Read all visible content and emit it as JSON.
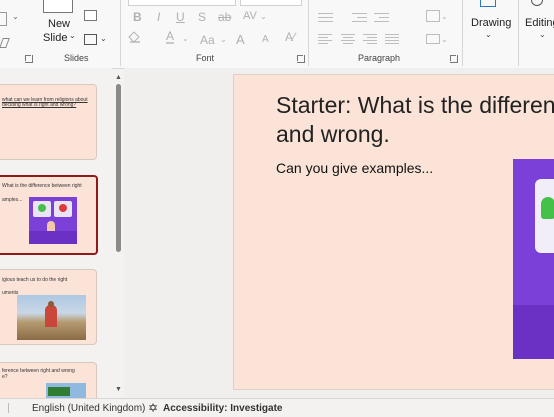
{
  "ribbon": {
    "new_slide_label_line1": "New",
    "new_slide_label_line2": "Slide",
    "groups": {
      "slides": "Slides",
      "font": "Font",
      "paragraph": "Paragraph"
    },
    "format_buttons": {
      "bold": "B",
      "italic": "I",
      "underline": "U",
      "shadow": "S",
      "strike": "ab",
      "case": "Aa",
      "grow": "A",
      "shrink": "A"
    },
    "drawing_label": "Drawing",
    "editing_label": "Editing"
  },
  "thumbnails": [
    {
      "number": "",
      "lines": [
        "what can we learn from religions about",
        "deciding what is right and wrong?"
      ]
    },
    {
      "number": "",
      "lines": [
        "What is the difference between right",
        "and wrong?",
        "",
        "amples..."
      ]
    },
    {
      "number": "",
      "lines": [
        "igious teach us to do the right",
        "",
        "uments"
      ]
    },
    {
      "number": "",
      "lines": [
        "ference between right and wrong",
        "e?"
      ]
    }
  ],
  "slide": {
    "title_line1": "Starter: What is the differen",
    "title_line2": "and wrong.",
    "subtitle": "Can you give examples..."
  },
  "status": {
    "language": "English (United Kingdom)",
    "accessibility": "Accessibility: Investigate"
  },
  "colors": {
    "slide_bg": "#fbe3d8",
    "purple": "#7b40d8",
    "active_thumb_border": "#8e1b1b"
  }
}
